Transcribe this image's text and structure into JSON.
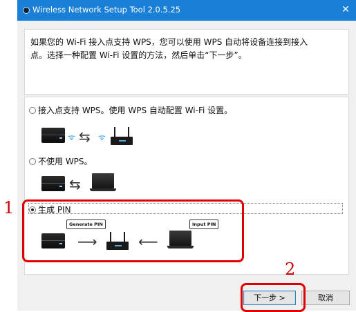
{
  "window": {
    "title": "Wireless Network Setup Tool 2.0.5.25",
    "close_glyph": "✕"
  },
  "intro": {
    "line1": "如果您的 Wi-Fi 接入点支持 WPS，您可以使用 WPS 自动将设备连接到接入",
    "line2": "点。选择一种配置 Wi-Fi 设置的方法，然后单击“下一步”。"
  },
  "options": [
    {
      "label": "接入点支持 WPS。使用 WPS 自动配置 Wi-Fi 设置。",
      "selected": false
    },
    {
      "label": "不使用 WPS。",
      "selected": false
    },
    {
      "label": "生成 PIN",
      "selected": true
    }
  ],
  "diagram": {
    "generate_pin_tag": "Generate PIN",
    "input_pin_tag": "Input PIN",
    "wifi_glyph": "ᯤ",
    "swap_glyph": "⇆",
    "arrow_right_glyph": "⟶",
    "arrow_left_glyph": "⟵"
  },
  "buttons": {
    "next": "下一步 >",
    "cancel": "取消"
  },
  "annotations": {
    "step1": "1",
    "step2": "2"
  },
  "colors": {
    "titlebar": "#1a7fd6",
    "annotation_red": "#e00000"
  }
}
